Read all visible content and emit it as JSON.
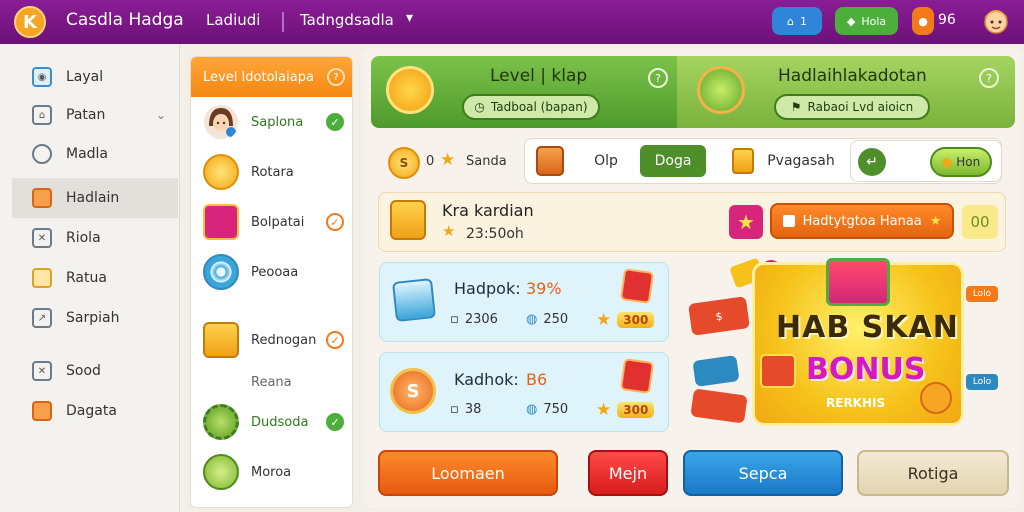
{
  "topbar": {
    "logo_letter": "K",
    "app_title": "Casdla Hadga",
    "nav_a": "Ladiudi",
    "nav_b": "Tadngdsadla",
    "pill_home": "1",
    "pill_green": "Hola",
    "count": "96",
    "colors": {
      "bar": "#7a168a",
      "home": "#2f86d8",
      "green": "#4caf3c",
      "orange": "#f27a18"
    }
  },
  "sidebar": {
    "items": [
      {
        "label": "Layal",
        "icon": "target-icon"
      },
      {
        "label": "Patan",
        "icon": "house-icon",
        "has_chevron": true
      },
      {
        "label": "Madla",
        "icon": "chat-icon"
      },
      {
        "label": "Hadlain",
        "icon": "diamond-icon",
        "active": true
      },
      {
        "label": "Riola",
        "icon": "chart-icon"
      },
      {
        "label": "Ratua",
        "icon": "card-icon"
      },
      {
        "label": "Sarpiah",
        "icon": "chart-icon"
      },
      {
        "label": "Sood",
        "icon": "x-icon"
      },
      {
        "label": "Dagata",
        "icon": "diamond-icon"
      }
    ]
  },
  "list": {
    "header": "Level Idotolaiapa",
    "rows": [
      {
        "label": "Saplona",
        "check": "green"
      },
      {
        "label": "Rotara",
        "check": ""
      },
      {
        "label": "Bolpatai",
        "check": "orange"
      },
      {
        "label": "Peooaa",
        "check": ""
      },
      {
        "label": "Rednogan",
        "check": "orange"
      },
      {
        "label": "Reana",
        "check": ""
      },
      {
        "label": "Dudsoda",
        "check": "green"
      },
      {
        "label": "Moroa",
        "check": ""
      }
    ]
  },
  "banners": {
    "left": {
      "title": "Level | klap",
      "button": "Tadboal (bapan)"
    },
    "right": {
      "title": "Hadlaihlakadotan",
      "button": "Rabaoi Lvd aioicn"
    }
  },
  "filters": {
    "coin_label": "0",
    "star_label": "Sanda",
    "seg_1": "Olp",
    "seg_2_active": "Doga",
    "seg_3": "Pvagasah",
    "action_btn": "Hon"
  },
  "reward": {
    "title": "Kra kardian",
    "sub": "23:50oh",
    "button": "Hadtytgtoa Hanaa",
    "count": "00"
  },
  "cards": [
    {
      "title": "Hadpok:",
      "pct": "39%",
      "meta1": "2306",
      "meta2": "250",
      "gold": "300"
    },
    {
      "title": "Kadhok:",
      "pct": "B6",
      "meta1": "38",
      "meta2": "750",
      "gold": "300"
    }
  ],
  "bonus": {
    "line1": "HAB SKAN",
    "line2": "BONUS",
    "line3": "RERKHIS",
    "tag_left_top": "95",
    "tag_left_bot": "",
    "tag_right_top": "Lolo",
    "tag_right_bot": "Lolo"
  },
  "bottom_buttons": {
    "b1": "Loomaen",
    "b2": "Mejn",
    "b3": "Sepca",
    "b4": "Rotiga"
  }
}
